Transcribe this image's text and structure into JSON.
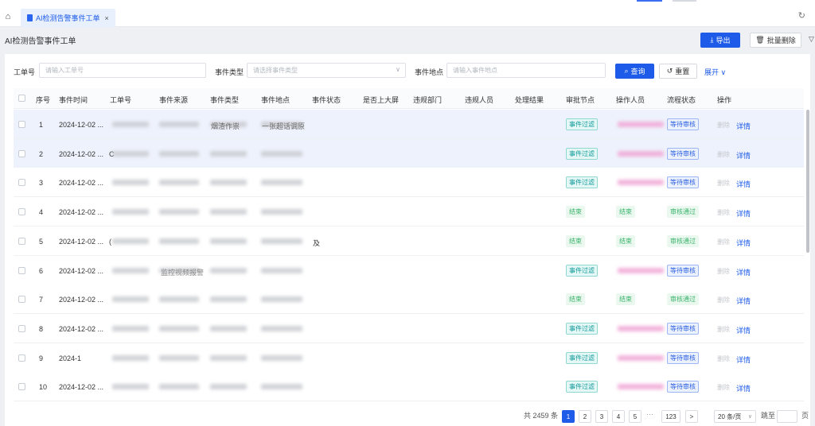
{
  "tab": {
    "home_icon": "home-icon",
    "label": "AI检测告警事件工单",
    "close": "×",
    "refresh_icon": "refresh-icon"
  },
  "page": {
    "title": "AI检测告警事件工单"
  },
  "toolbar": {
    "export_label": "导出",
    "batch_delete_label": "批量删除"
  },
  "query": {
    "order_no_label": "工单号",
    "order_no_placeholder": "请输入工单号",
    "type_label": "事件类型",
    "type_placeholder": "请选择事件类型",
    "location_label": "事件地点",
    "location_placeholder": "请输入事件地点",
    "search_label": "查询",
    "reset_label": "重置",
    "expand_label": "展开"
  },
  "columns": [
    "序号",
    "事件时间",
    "工单号",
    "事件来源",
    "事件类型",
    "事件地点",
    "事件状态",
    "是否上大屏",
    "违规部门",
    "违规人员",
    "处理结果",
    "审批节点",
    "操作人员",
    "流程状态",
    "操作"
  ],
  "rows": [
    {
      "no": "1",
      "time": "2024-12-02 ...",
      "order_frag": "",
      "type": "烟渣作祟",
      "location": "一张超话调原",
      "node": "事件过滤",
      "node_style": "cyan",
      "operator_style": "pink",
      "status": "等待审核",
      "status_style": "blue",
      "selected": true
    },
    {
      "no": "2",
      "time": "2024-12-02 ...",
      "order_frag": "C",
      "type": "",
      "location": "",
      "node": "事件过滤",
      "node_style": "cyan",
      "operator_style": "pink",
      "status": "等待审核",
      "status_style": "blue",
      "selected": true
    },
    {
      "no": "3",
      "time": "2024-12-02 ...",
      "order_frag": "",
      "type": "",
      "location": "",
      "node": "事件过滤",
      "node_style": "cyan",
      "operator_style": "pink",
      "status": "等待审核",
      "status_style": "blue",
      "selected": false
    },
    {
      "no": "4",
      "time": "2024-12-02 ...",
      "order_frag": "",
      "type": "",
      "location": "",
      "node": "结束",
      "node_style": "green",
      "operator": "结束",
      "operator_style": "green",
      "status": "审核通过",
      "status_style": "green",
      "selected": false
    },
    {
      "no": "5",
      "time": "2024-12-02 ...",
      "order_frag": "(",
      "type": "",
      "location": "",
      "extra": "及",
      "node": "结束",
      "node_style": "green",
      "operator": "结束",
      "operator_style": "green",
      "status": "审核通过",
      "status_style": "green",
      "selected": false
    },
    {
      "no": "6",
      "time": "2024-12-02 ...",
      "order_frag": "",
      "source_text": "监控视频报警",
      "type": "",
      "location": "",
      "node": "事件过滤",
      "node_style": "cyan",
      "operator_style": "pink",
      "status": "等待审核",
      "status_style": "blue",
      "selected": false
    },
    {
      "no": "7",
      "time": "2024-12-02 ...",
      "order_frag": "",
      "type": "",
      "location": "",
      "node": "结束",
      "node_style": "green",
      "operator": "结束",
      "operator_style": "green",
      "status": "审核通过",
      "status_style": "green",
      "selected": false
    },
    {
      "no": "8",
      "time": "2024-12-02 ...",
      "order_frag": "",
      "type": "",
      "location": "",
      "node": "事件过滤",
      "node_style": "cyan",
      "operator_style": "pink",
      "status": "等待审核",
      "status_style": "blue",
      "selected": false
    },
    {
      "no": "9",
      "time": "2024-1",
      "order_frag": "",
      "type": "",
      "location": "",
      "node": "事件过滤",
      "node_style": "cyan",
      "operator_style": "pink",
      "status": "等待审核",
      "status_style": "blue",
      "selected": false
    },
    {
      "no": "10",
      "time": "2024-12-02 ...",
      "order_frag": "",
      "type": "",
      "location": "",
      "node": "事件过滤",
      "node_style": "cyan",
      "operator_style": "pink",
      "status": "等待审核",
      "status_style": "blue",
      "selected": false
    }
  ],
  "row_actions": {
    "delete": "删除",
    "detail": "详情"
  },
  "pagination": {
    "total": "共 2459 条",
    "pages": [
      "1",
      "2",
      "3",
      "4",
      "5"
    ],
    "ellipsis": "···",
    "last": "123",
    "next": ">",
    "page_size": "20 条/页",
    "jump_label": "跳至",
    "page_unit": "页"
  },
  "colors": {
    "primary": "#1d5be8",
    "cyan_tag": "#0f9a9a",
    "green_tag": "#39b36b",
    "blue_tag": "#2a5fe0"
  }
}
